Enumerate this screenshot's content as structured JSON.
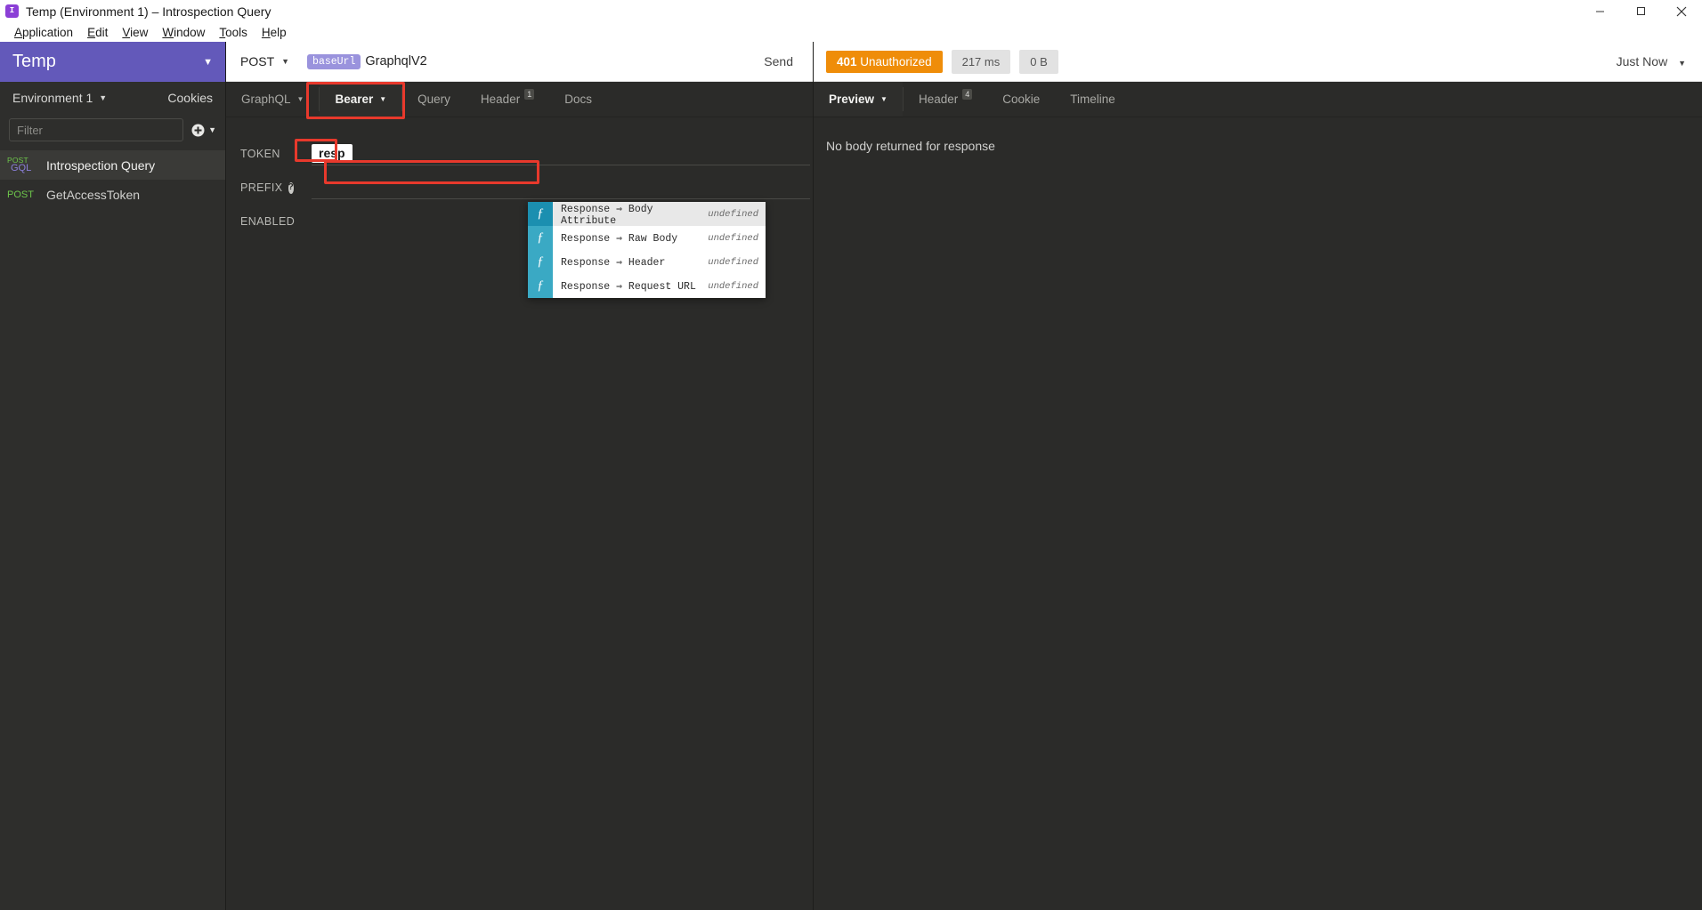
{
  "window": {
    "title": "Temp (Environment 1) – Introspection Query",
    "app_icon": "insomnia-logo-icon",
    "minimize_label": "minimize-icon",
    "maximize_label": "maximize-icon",
    "close_label": "close-icon"
  },
  "menu": {
    "items": [
      {
        "label": "Application",
        "accel": "A"
      },
      {
        "label": "Edit",
        "accel": "E"
      },
      {
        "label": "View",
        "accel": "V"
      },
      {
        "label": "Window",
        "accel": "W"
      },
      {
        "label": "Tools",
        "accel": "T"
      },
      {
        "label": "Help",
        "accel": "H"
      }
    ]
  },
  "sidebar": {
    "workspace_name": "Temp",
    "workspace_caret": "▼",
    "environment_label": "Environment 1",
    "environment_caret": "▼",
    "cookies_label": "Cookies",
    "filter_placeholder": "Filter",
    "filter_value": "",
    "add_icon": "plus-circle-icon",
    "add_caret": "▼",
    "requests": [
      {
        "method_top": "POST",
        "method_bottom": "GQL",
        "name": "Introspection Query",
        "type": "graphql",
        "active": true
      },
      {
        "method_top": "POST",
        "method_bottom": "",
        "name": "GetAccessToken",
        "type": "post",
        "active": false
      }
    ]
  },
  "request": {
    "method": "POST",
    "method_caret": "▼",
    "url_chip": "baseUrl",
    "url_text": "GraphqlV2",
    "send_label": "Send",
    "tabs": [
      {
        "label": "GraphQL",
        "caret": "▼",
        "active": false,
        "badge": ""
      },
      {
        "label": "Bearer",
        "caret": "▼",
        "active": true,
        "badge": ""
      },
      {
        "label": "Query",
        "caret": "",
        "active": false,
        "badge": ""
      },
      {
        "label": "Header",
        "caret": "",
        "active": false,
        "badge": "1"
      },
      {
        "label": "Docs",
        "caret": "",
        "active": false,
        "badge": ""
      }
    ],
    "auth": {
      "token_label": "TOKEN",
      "token_value": "resp",
      "prefix_label": "PREFIX",
      "prefix_help_icon": "help-icon",
      "prefix_value": "",
      "enabled_label": "ENABLED"
    }
  },
  "autocomplete": {
    "items": [
      {
        "icon": "function-icon",
        "label": "Response ⇒ Body Attribute",
        "meta": "undefined",
        "selected": true
      },
      {
        "icon": "function-icon",
        "label": "Response ⇒ Raw Body",
        "meta": "undefined",
        "selected": false
      },
      {
        "icon": "function-icon",
        "label": "Response ⇒ Header",
        "meta": "undefined",
        "selected": false
      },
      {
        "icon": "function-icon",
        "label": "Response ⇒ Request URL",
        "meta": "undefined",
        "selected": false
      }
    ]
  },
  "response": {
    "status_code": "401",
    "status_text": " Unauthorized",
    "time": "217 ms",
    "size": "0 B",
    "timestamp_label": "Just Now",
    "timestamp_caret": "▼",
    "tabs": [
      {
        "label": "Preview",
        "caret": "▼",
        "active": true,
        "badge": ""
      },
      {
        "label": "Header",
        "caret": "",
        "active": false,
        "badge": "4"
      },
      {
        "label": "Cookie",
        "caret": "",
        "active": false,
        "badge": ""
      },
      {
        "label": "Timeline",
        "caret": "",
        "active": false,
        "badge": ""
      }
    ],
    "empty_message": "No body returned for response"
  },
  "colors": {
    "accent_purple": "#6359ba",
    "status_orange": "#ef8d09",
    "annotation_red": "#e8392c",
    "function_teal": "#3aa9c4",
    "method_green": "#6ec64b"
  }
}
